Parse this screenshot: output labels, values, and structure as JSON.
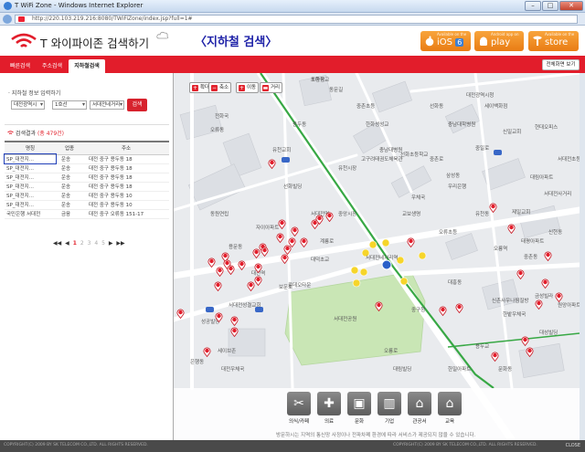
{
  "window": {
    "title": "T WiFi Zone - Windows Internet Explorer",
    "buttons": [
      "–",
      "□",
      "✕"
    ]
  },
  "address_bar": {
    "url": "http://220.103.219.216:8080/TWiFiZone/index.jsp?full=1#"
  },
  "header": {
    "logo_text": "T 와이파이존 검색하기",
    "page_title": "〈지하철 검색〉",
    "stores": [
      {
        "sub": "Available on the",
        "main": "iOS",
        "badge": "6"
      },
      {
        "sub": "Android app on",
        "main": "play"
      },
      {
        "sub": "Available on the",
        "main": "store"
      }
    ]
  },
  "tabs": [
    "빠른검색",
    "주소검색",
    "지하철검색"
  ],
  "active_tab": "지하철검색",
  "fullmap_label": "전체화면 보기",
  "search": {
    "title": "지하철 정보 입력하기",
    "region": "대전광역시",
    "line": "1호선",
    "station": "서대전네거리",
    "button": "검색"
  },
  "results": {
    "title": "검색결과",
    "count": "(총 479건)",
    "headers": [
      "명칭",
      "업종",
      "주소"
    ],
    "rows": [
      [
        "SP_대전지...",
        "운송",
        "대전 중구 용두동 18"
      ],
      [
        "SP_대전지...",
        "운송",
        "대전 중구 용두동 18"
      ],
      [
        "SP_대전지...",
        "운송",
        "대전 중구 용두동 18"
      ],
      [
        "SP_대전지...",
        "운송",
        "대전 중구 용두동 18"
      ],
      [
        "SP_대전지...",
        "운송",
        "대전 중구 용두동 10"
      ],
      [
        "SP_대전지...",
        "운송",
        "대전 중구 용두동 10"
      ],
      [
        "국민은행 서대전",
        "금융",
        "대전 중구 오류동 151-17"
      ]
    ],
    "selected_row": 0,
    "pager": {
      "first": "◀◀",
      "prev": "◀",
      "pages": [
        "1",
        "2",
        "3",
        "4",
        "5"
      ],
      "current": "1",
      "next": "▶",
      "last": "▶▶"
    }
  },
  "map_controls": [
    {
      "label": "확대",
      "glyph": "+"
    },
    {
      "label": "축소",
      "glyph": "−"
    },
    {
      "label": "이동",
      "glyph": "+"
    },
    {
      "label": "거리",
      "glyph": "▬"
    }
  ],
  "map_labels": [
    "초등학교",
    "동문길",
    "중촌초등",
    "용두동",
    "오류동",
    "유천교회",
    "충남대병원",
    "전화국",
    "고구려태권도체육관",
    "선화초등학교",
    "중촌로",
    "중일로",
    "서대전네거리역",
    "서대전공원",
    "제일교회",
    "신촌사우나찜질방",
    "한밭우체국",
    "교보생명",
    "우체국",
    "우리은행",
    "동원연립",
    "자이아파트",
    "선화빌딩",
    "계룡로",
    "용문동",
    "삼성동",
    "세이백화점",
    "성공빌딩",
    "한화성성교",
    "충남대학병원",
    "서대전성결교회",
    "대전광역시청",
    "선화동",
    "신일교회",
    "현대오피스",
    "서대전초등",
    "대림아파트",
    "서대전사거리",
    "태평아파트",
    "유천동",
    "오류초등",
    "오룡역",
    "대덕초교",
    "중앙시장",
    "대전역",
    "보문로",
    "은행동",
    "세이브존",
    "대전우체국",
    "로데오타운",
    "중구청",
    "대흥동",
    "오룡로",
    "용두교",
    "중촌동",
    "신현동",
    "대림빌딩",
    "한일아파트",
    "금성빌라",
    "원앙아파트",
    "대성빌딩",
    "문화동",
    "서대전역",
    "유천시장",
    "도마동"
  ],
  "categories": [
    "의식/카페",
    "의료",
    "문화",
    "기업",
    "관공서",
    "교육"
  ],
  "category_icons": [
    "fork-knife-icon",
    "medical-icon",
    "culture-icon",
    "building-icon",
    "government-icon",
    "education-icon"
  ],
  "notice": "방문하시는 지역의 통신망 사정이나 전파차폐 환경에 따라 서비스가 제공되지 않을 수 있습니다.",
  "footer": {
    "left": "COPYRIGHT(C) 2009 BY SK TELECOM CO.,LTD. ALL RIGHTS RESERVED.",
    "right": "COPYRIGHT(C) 2009 BY SK TELECOM CO.,LTD. ALL RIGHTS RESERVED.",
    "close": "CLOSE"
  },
  "colors": {
    "accent": "#e21d2b",
    "title_blue": "#1e22a8",
    "store_orange": "#ee8a1f",
    "park_green": "#c9e6b5",
    "subway_yellow": "#f2c400"
  }
}
